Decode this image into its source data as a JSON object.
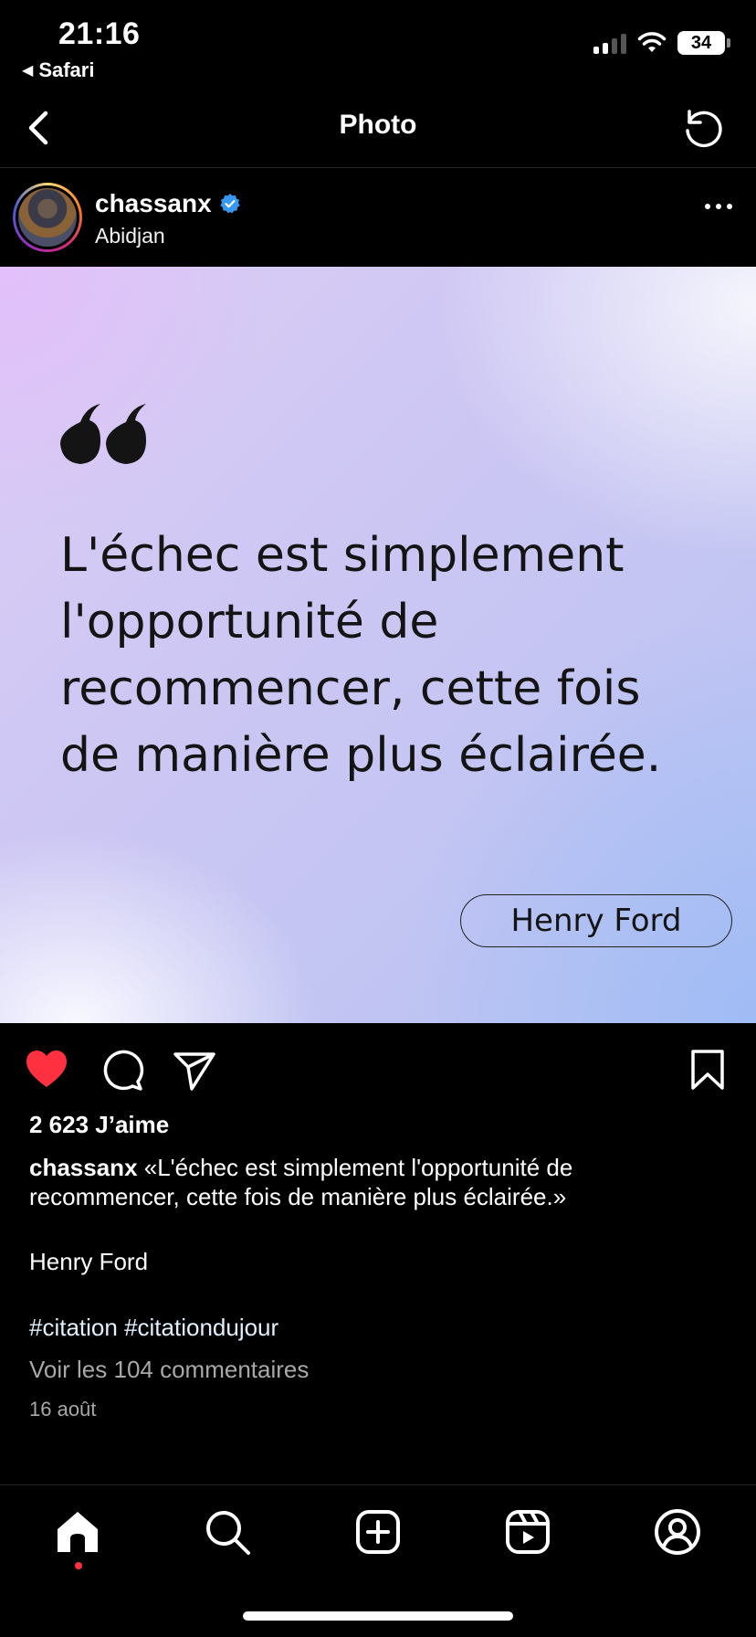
{
  "status_bar": {
    "time": "21:16",
    "back_app": "Safari",
    "battery": "34"
  },
  "nav": {
    "title": "Photo"
  },
  "post": {
    "username": "chassanx",
    "location": "Abidjan",
    "image": {
      "quote": "L'échec est simplement l'opportunité de recommencer, cette fois de manière plus éclairée.",
      "author": "Henry Ford"
    },
    "likes": "2 623 J’aime",
    "caption_user": "chassanx",
    "caption_text": "«L'échec est simplement l'opportunité de recommencer, cette fois de manière plus éclairée.»",
    "caption_author": "Henry Ford",
    "hashtags": "#citation #citationdujour",
    "view_comments": "Voir les 104 commentaires",
    "date": "16 août",
    "liked": true
  },
  "icons": {
    "back": "chevron-left-icon",
    "refresh": "refresh-icon",
    "more": "more-horizontal-icon",
    "verified": "verified-badge-icon",
    "like": "heart-filled-icon",
    "comment": "comment-icon",
    "share": "send-icon",
    "save": "bookmark-icon",
    "tabs": [
      "home-icon",
      "search-icon",
      "create-icon",
      "reels-icon",
      "profile-icon"
    ]
  },
  "colors": {
    "background": "#000000",
    "like_red": "#ff3040",
    "verified_blue": "#3897f0",
    "muted_text": "#a8a8a8",
    "hashtag": "#e0f1ff"
  }
}
